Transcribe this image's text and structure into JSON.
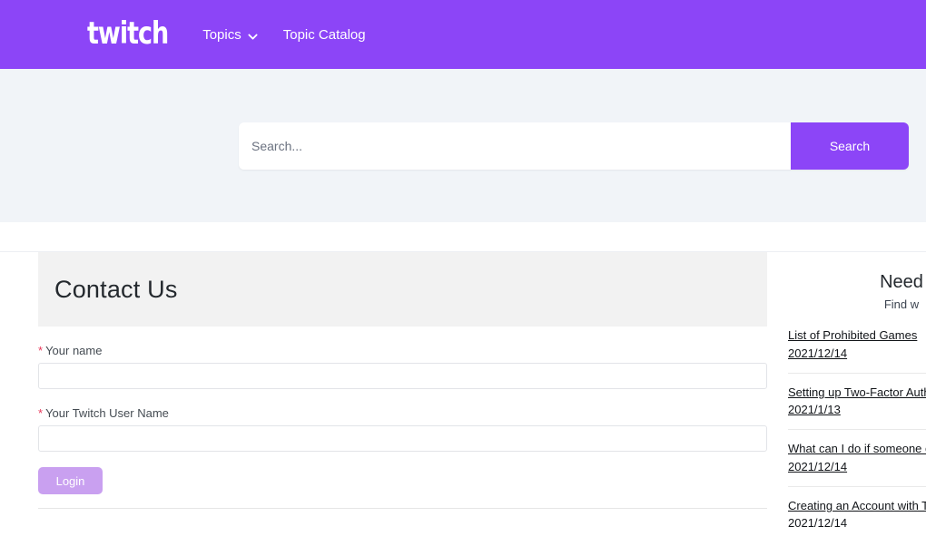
{
  "header": {
    "brand": "twitch",
    "nav": [
      {
        "label": "Topics",
        "icon": "chevron-down-icon",
        "has_dropdown": true
      },
      {
        "label": "Topic Catalog",
        "has_dropdown": false
      }
    ]
  },
  "search": {
    "placeholder": "Search...",
    "value": "",
    "button_label": "Search"
  },
  "form": {
    "title": "Contact Us",
    "required_mark": "*",
    "fields": [
      {
        "label": "Your name",
        "value": "",
        "required": true
      },
      {
        "label": "Your Twitch User Name",
        "value": "",
        "required": true
      }
    ],
    "submit_label": "Login"
  },
  "sidebar": {
    "title": "Need",
    "subtitle": "Find w",
    "articles": [
      {
        "title": "List of Prohibited Games",
        "date": "2021/12/14"
      },
      {
        "title": "Setting up Two-Factor Authe",
        "date": "2021/1/13"
      },
      {
        "title": "What can I do if someone el",
        "date": "2021/12/14"
      },
      {
        "title": "Creating an Account with Tw",
        "date": "2021/12/14"
      }
    ]
  },
  "colors": {
    "brand_purple": "#8C45F7",
    "login_purple": "#C9A0F0",
    "search_bg": "#F1F4F8",
    "panel_gray": "#F2F2F2",
    "required_red": "#e8385a"
  }
}
